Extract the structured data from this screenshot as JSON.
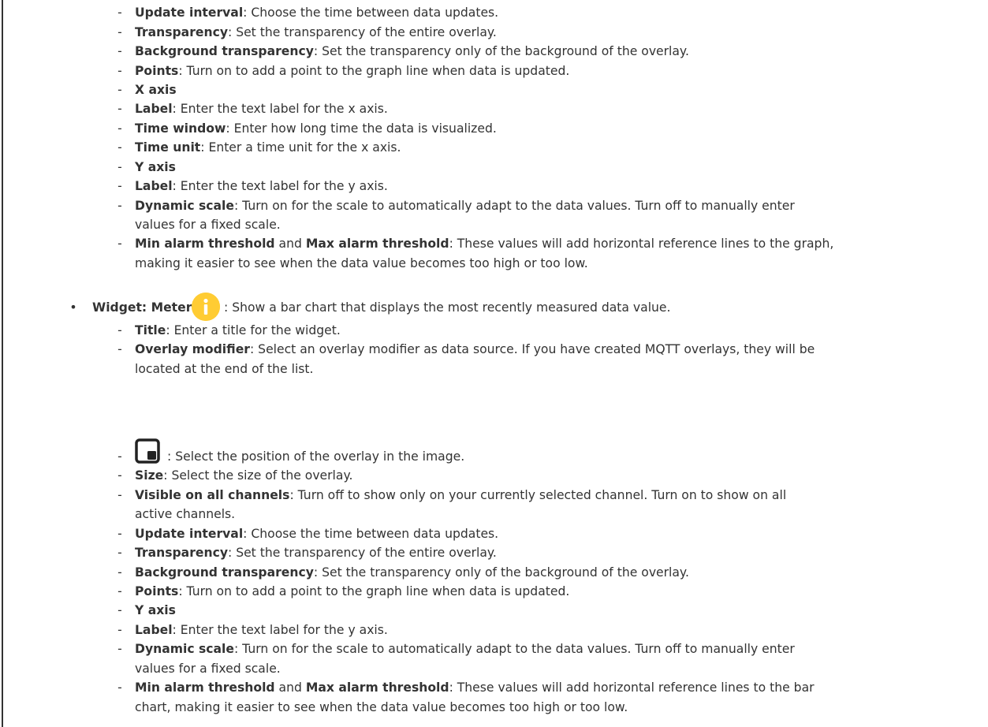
{
  "colors": {
    "text": "#333333",
    "info_icon": "#ffcc33",
    "background": "#ffffff"
  },
  "icons": {
    "info": "info-icon",
    "position": "overlay-position-icon"
  },
  "graph_items": [
    {
      "bold": "Update interval",
      "text": ": Choose the time between data updates."
    },
    {
      "bold": "Transparency",
      "text": ": Set the transparency of the entire overlay."
    },
    {
      "bold": "Background transparency",
      "text": ": Set the transparency only of the background of the overlay."
    },
    {
      "bold": "Points",
      "text": ": Turn on to add a point to the graph line when data is updated."
    },
    {
      "bold": "X axis",
      "text": ""
    },
    {
      "bold": "Label",
      "text": ": Enter the text label for the x axis."
    },
    {
      "bold": "Time window",
      "text": ": Enter how long time the data is visualized."
    },
    {
      "bold": "Time unit",
      "text": ": Enter a time unit for the x axis."
    },
    {
      "bold": "Y axis",
      "text": ""
    },
    {
      "bold": "Label",
      "text": ": Enter the text label for the y axis."
    },
    {
      "bold": "Dynamic scale",
      "text": ": Turn on for the scale to automatically adapt to the data values. Turn off to manually enter",
      "text2": "values for a fixed scale."
    },
    {
      "bold": "Min alarm threshold",
      "mid": " and ",
      "bold2": "Max alarm threshold",
      "text": ": These values will add horizontal reference lines to the graph,",
      "text2": "making it easier to see when the data value becomes too high or too low."
    }
  ],
  "meter": {
    "label": "Widget: Meter",
    "description": ": Show a bar chart that displays the most recently measured data value."
  },
  "meter_items": [
    {
      "bold": "Title",
      "text": ": Enter a title for the widget."
    },
    {
      "bold": "Overlay modifier",
      "text": ": Select an overlay modifier as data source. If you have created MQTT overlays, they will be",
      "text2": "located at the end of the list."
    },
    {
      "text": ": Select the position of the overlay in the image."
    },
    {
      "bold": "Size",
      "text": ": Select the size of the overlay."
    },
    {
      "bold": "Visible on all channels",
      "text": ": Turn off to show only on your currently selected channel. Turn on to show on all",
      "text2": "active channels."
    },
    {
      "bold": "Update interval",
      "text": ": Choose the time between data updates."
    },
    {
      "bold": "Transparency",
      "text": ": Set the transparency of the entire overlay."
    },
    {
      "bold": "Background transparency",
      "text": ": Set the transparency only of the background of the overlay."
    },
    {
      "bold": "Points",
      "text": ": Turn on to add a point to the graph line when data is updated."
    },
    {
      "bold": "Y axis",
      "text": ""
    },
    {
      "bold": "Label",
      "text": ": Enter the text label for the y axis."
    },
    {
      "bold": "Dynamic scale",
      "text": ": Turn on for the scale to automatically adapt to the data values. Turn off to manually enter",
      "text2": "values for a fixed scale."
    },
    {
      "bold": "Min alarm threshold",
      "mid": " and ",
      "bold2": "Max alarm threshold",
      "text": ": These values will add horizontal reference lines to the bar",
      "text2": "chart, making it easier to see when the data value becomes too high or too low."
    }
  ]
}
